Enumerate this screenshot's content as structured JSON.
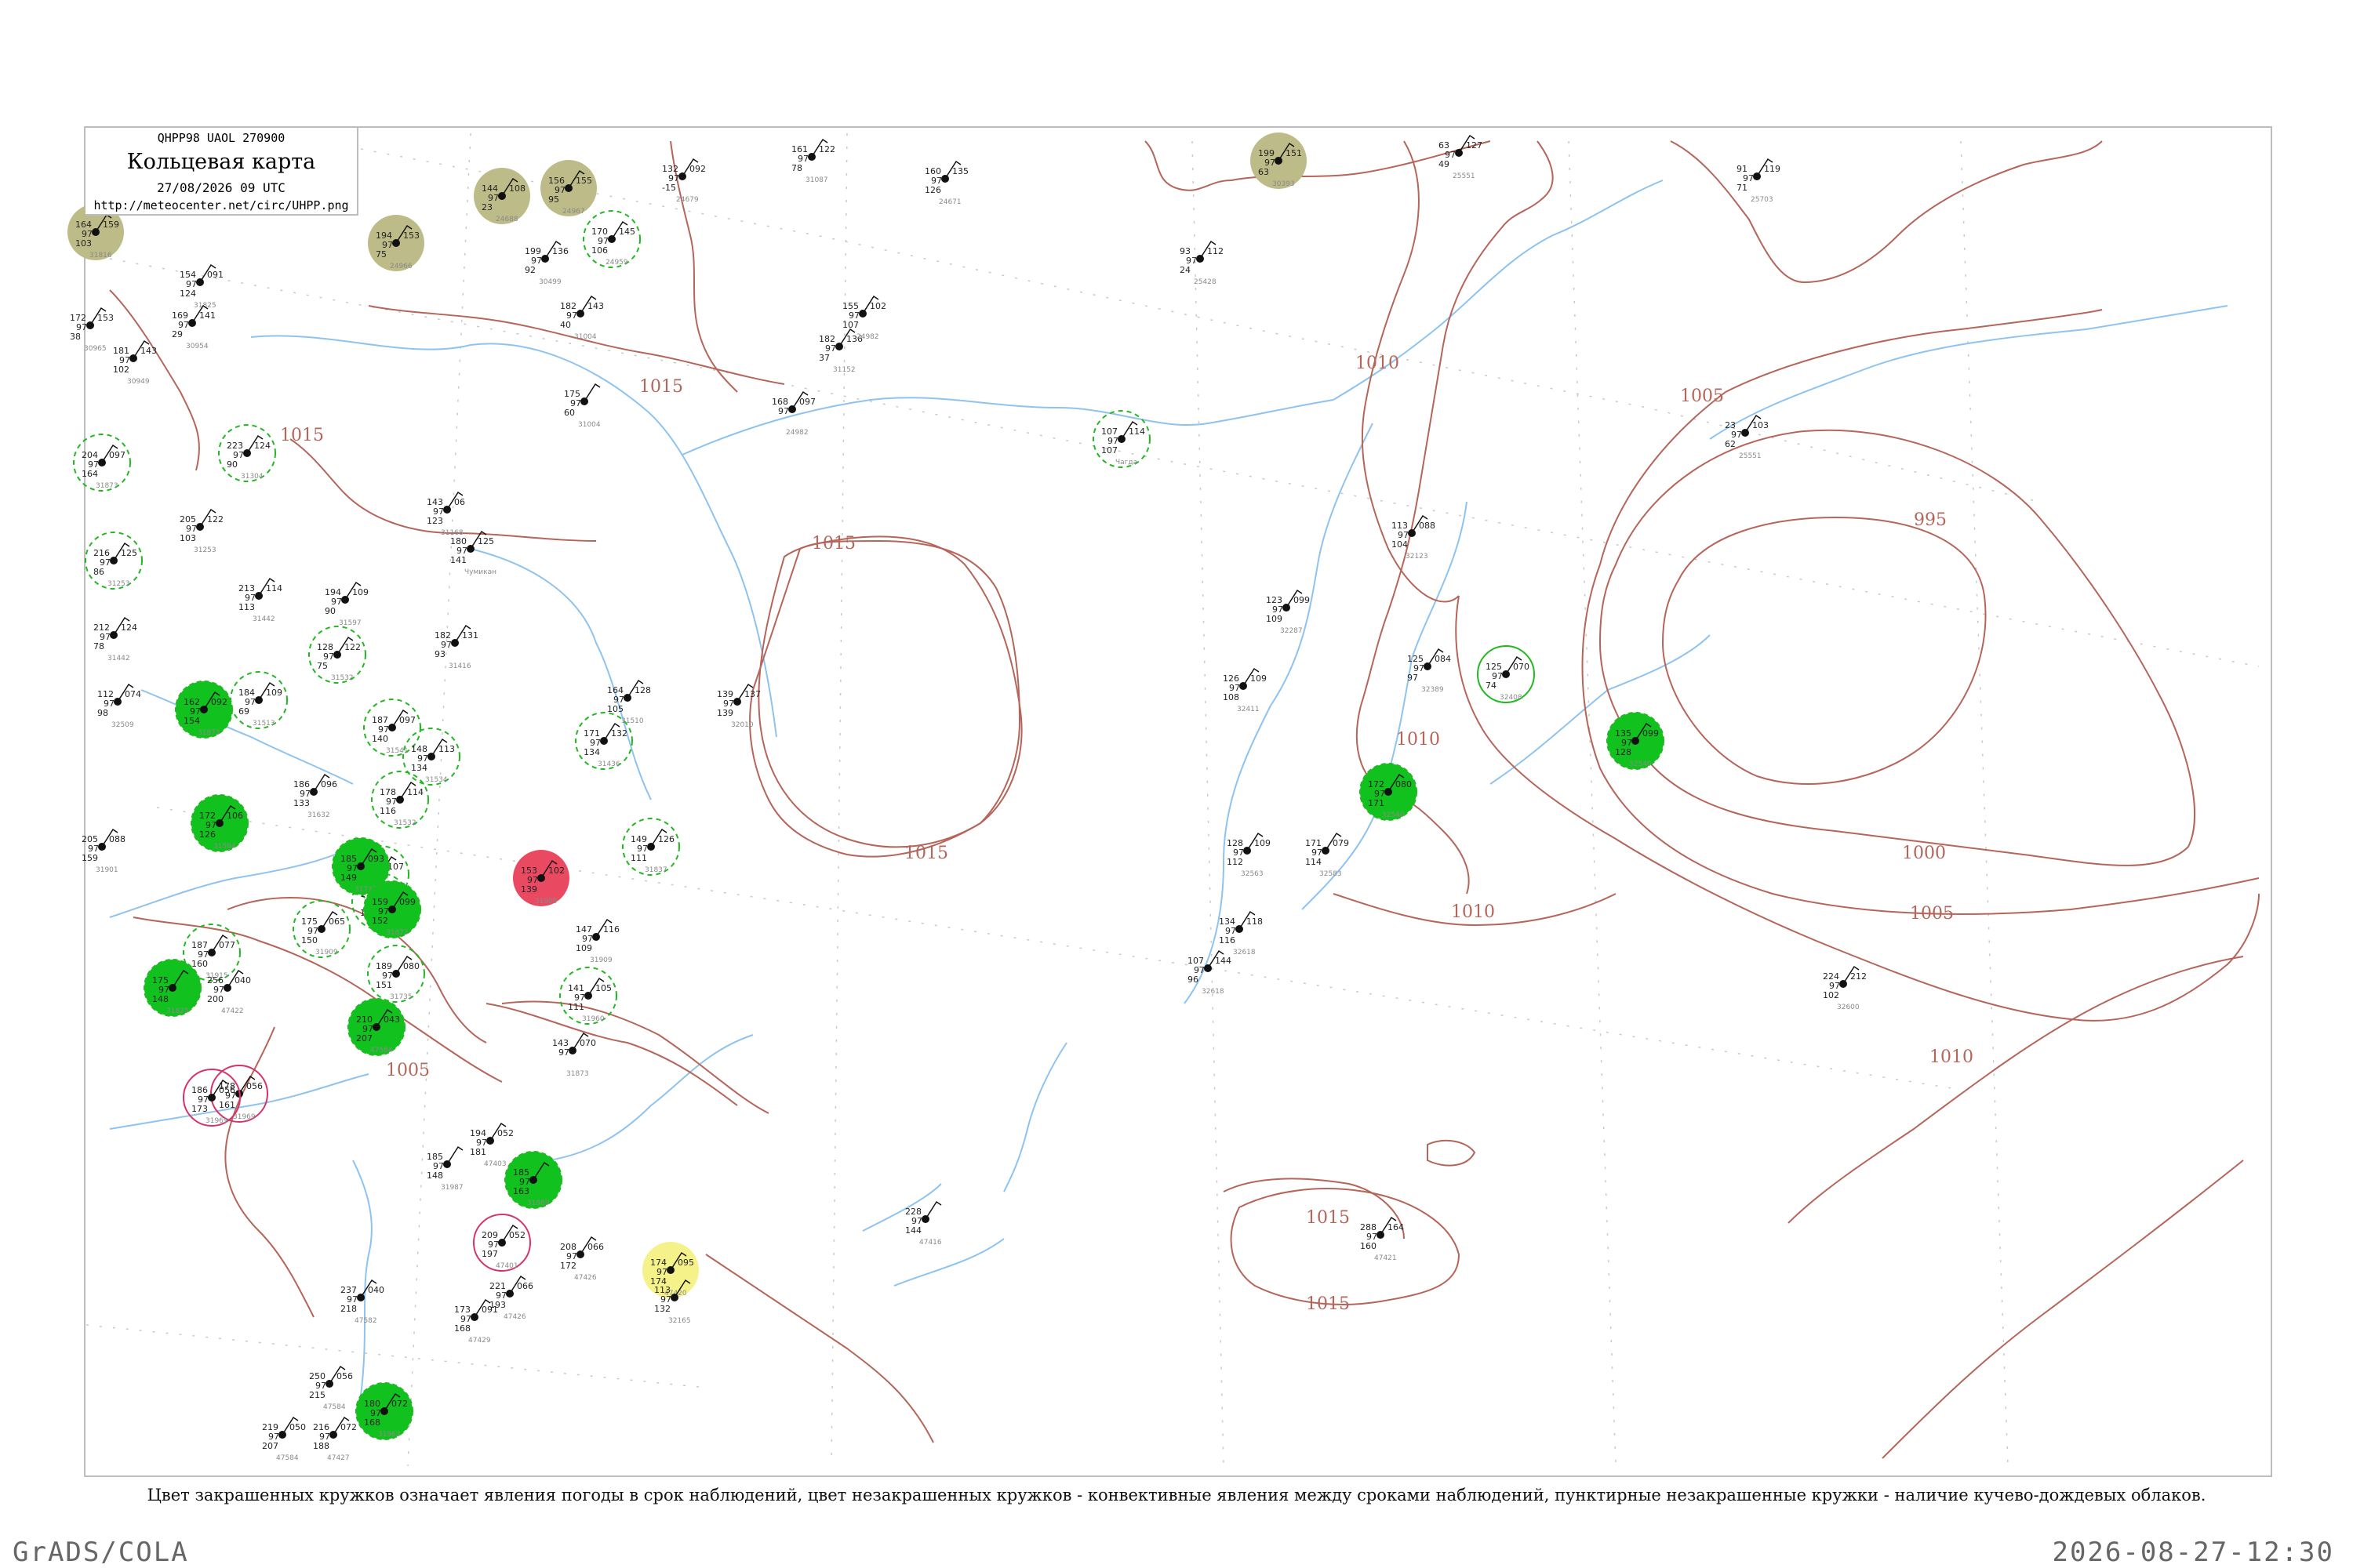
{
  "header": {
    "code_line": "QHPP98  UAOL  270900",
    "title": "Кольцевая карта",
    "date": "27/08/2026 09 UTC",
    "url": "http://meteocenter.net/circ/UHPP.png"
  },
  "caption": "Цвет закрашенных кружков означает явления погоды в срок наблюдений, цвет незакрашенных кружков - конвективные явления между сроками наблюдений, пунктирные незакрашенные кружки - наличие кучево-дождевых облаков.",
  "footer": {
    "left": "GrADS/COLA",
    "right": "2026-08-27-12:30"
  },
  "colors": {
    "isobar": "#b5655a",
    "coast": "#8fc3ef",
    "rain_fill": "#11c21f",
    "rain_ring": "#22b822",
    "thunder_fill": "#e94a62",
    "thunder_ring": "#d6336c",
    "fog_fill": "#bdbb87",
    "drizzle_fill": "#f6f28a"
  },
  "isobar_labels": [
    {
      "text": "1015"
    },
    {
      "text": "1015"
    },
    {
      "text": "1015"
    },
    {
      "text": "1015"
    },
    {
      "text": "1015"
    },
    {
      "text": "1015"
    },
    {
      "text": "1010"
    },
    {
      "text": "1010"
    },
    {
      "text": "1010"
    },
    {
      "text": "1010"
    },
    {
      "text": "1005"
    },
    {
      "text": "1005"
    },
    {
      "text": "1005"
    },
    {
      "text": "1000"
    },
    {
      "text": "995"
    }
  ],
  "stations": [
    {
      "num": "143",
      "val": "06",
      "low": "123",
      "name": "31168",
      "kind": "plain"
    },
    {
      "num": "180",
      "val": "125",
      "low": "141",
      "name": "Чумикан",
      "kind": "plain"
    },
    {
      "num": "128",
      "val": "122",
      "low": "75",
      "name": "31532",
      "kind": "cb"
    },
    {
      "num": "182",
      "val": "131",
      "low": "93",
      "name": "31416",
      "kind": "plain"
    },
    {
      "num": "164",
      "val": "128",
      "low": "105",
      "name": "31510",
      "kind": "plain"
    },
    {
      "num": "139",
      "val": "137",
      "low": "139",
      "name": "32010",
      "kind": "plain"
    },
    {
      "num": "171",
      "val": "132",
      "low": "134",
      "name": "31436",
      "kind": "cb"
    },
    {
      "num": "186",
      "val": "096",
      "low": "133",
      "name": "31632",
      "kind": "plain"
    },
    {
      "num": "149",
      "val": "126",
      "low": "111",
      "name": "31837",
      "kind": "cb"
    },
    {
      "num": "153",
      "val": "102",
      "low": "139",
      "name": "31909",
      "kind": "thunder"
    },
    {
      "num": "147",
      "val": "116",
      "low": "109",
      "name": "31909",
      "kind": "plain"
    },
    {
      "num": "141",
      "val": "105",
      "low": "111",
      "name": "31960",
      "kind": "cb"
    },
    {
      "num": "107",
      "val": "114",
      "low": "107",
      "name": "Чагда",
      "kind": "cb"
    },
    {
      "num": "113",
      "val": "088",
      "low": "104",
      "name": "32123",
      "kind": "plain"
    },
    {
      "num": "123",
      "val": "099",
      "low": "109",
      "name": "32287",
      "kind": "plain"
    },
    {
      "num": "126",
      "val": "109",
      "low": "108",
      "name": "32411",
      "kind": "plain"
    },
    {
      "num": "125",
      "val": "084",
      "low": "97",
      "name": "32389",
      "kind": "plain"
    },
    {
      "num": "125",
      "val": "070",
      "low": "74",
      "name": "32408",
      "kind": "ring"
    },
    {
      "num": "128",
      "val": "109",
      "low": "112",
      "name": "32563",
      "kind": "plain"
    },
    {
      "num": "171",
      "val": "079",
      "low": "114",
      "name": "32583",
      "kind": "plain"
    },
    {
      "num": "134",
      "val": "118",
      "low": "116",
      "name": "32618",
      "kind": "plain"
    },
    {
      "num": "107",
      "val": "144",
      "low": "96",
      "name": "32618",
      "kind": "plain"
    },
    {
      "num": "224",
      "val": "212",
      "low": "102",
      "name": "32600",
      "kind": "plain"
    },
    {
      "num": "228",
      "val": "",
      "low": "144",
      "name": "47416",
      "kind": "plain"
    },
    {
      "num": "288",
      "val": "164",
      "low": "160",
      "name": "47421",
      "kind": "plain"
    },
    {
      "num": "174",
      "val": "095",
      "low": "174",
      "name": "47420",
      "kind": "drizzle"
    },
    {
      "num": "208",
      "val": "066",
      "low": "172",
      "name": "47426",
      "kind": "plain"
    },
    {
      "num": "194",
      "val": "052",
      "low": "181",
      "name": "47403",
      "kind": "plain"
    },
    {
      "num": "185",
      "val": "",
      "low": "148",
      "name": "31987",
      "kind": "plain"
    },
    {
      "num": "209",
      "val": "052",
      "low": "197",
      "name": "47401",
      "kind": "thunder_ring"
    },
    {
      "num": "178",
      "val": "056",
      "low": "161",
      "name": "31969",
      "kind": "thunder_ring"
    },
    {
      "num": "186",
      "val": "056",
      "low": "173",
      "name": "31969",
      "kind": "thunder_ring"
    },
    {
      "num": "175",
      "val": "065",
      "low": "150",
      "name": "31909",
      "kind": "cb"
    },
    {
      "num": "187",
      "val": "077",
      "low": "160",
      "name": "31915",
      "kind": "cb"
    },
    {
      "num": "205",
      "val": "088",
      "low": "159",
      "name": "31901",
      "kind": "plain"
    },
    {
      "num": "204",
      "val": "097",
      "low": "164",
      "name": "31873",
      "kind": "cb"
    },
    {
      "num": "223",
      "val": "124",
      "low": "90",
      "name": "31304",
      "kind": "cb"
    },
    {
      "num": "205",
      "val": "122",
      "low": "103",
      "name": "31253",
      "kind": "plain"
    },
    {
      "num": "216",
      "val": "125",
      "low": "86",
      "name": "31253",
      "kind": "cb"
    },
    {
      "num": "212",
      "val": "124",
      "low": "78",
      "name": "31442",
      "kind": "plain"
    },
    {
      "num": "213",
      "val": "114",
      "low": "113",
      "name": "31442",
      "kind": "plain"
    },
    {
      "num": "194",
      "val": "109",
      "low": "90",
      "name": "31597",
      "kind": "plain"
    },
    {
      "num": "184",
      "val": "109",
      "low": "69",
      "name": "31513",
      "kind": "cb"
    },
    {
      "num": "187",
      "val": "097",
      "low": "140",
      "name": "31541",
      "kind": "cb"
    },
    {
      "num": "148",
      "val": "113",
      "low": "134",
      "name": "31534",
      "kind": "cb"
    },
    {
      "num": "178",
      "val": "114",
      "low": "116",
      "name": "31532",
      "kind": "cb"
    },
    {
      "num": "178",
      "val": "107",
      "low": "137",
      "name": "31643",
      "kind": "cb"
    },
    {
      "num": "176",
      "val": "060",
      "low": "141",
      "name": "31735",
      "kind": "cb"
    },
    {
      "num": "189",
      "val": "080",
      "low": "151",
      "name": "31735",
      "kind": "cb"
    },
    {
      "num": "154",
      "val": "091",
      "low": "124",
      "name": "31825",
      "kind": "plain"
    },
    {
      "num": "169",
      "val": "141",
      "low": "29",
      "name": "30954",
      "kind": "plain"
    },
    {
      "num": "172",
      "val": "153",
      "low": "38",
      "name": "30965",
      "kind": "plain"
    },
    {
      "num": "181",
      "val": "143",
      "low": "102",
      "name": "30949",
      "kind": "plain"
    },
    {
      "num": "199",
      "val": "136",
      "low": "92",
      "name": "30499",
      "kind": "plain"
    },
    {
      "num": "182",
      "val": "143",
      "low": "40",
      "name": "31004",
      "kind": "plain"
    },
    {
      "num": "175",
      "val": "",
      "low": "60",
      "name": "31004",
      "kind": "plain"
    },
    {
      "num": "182",
      "val": "136",
      "low": "37",
      "name": "31152",
      "kind": "plain"
    },
    {
      "num": "155",
      "val": "102",
      "low": "107",
      "name": "24982",
      "kind": "plain"
    },
    {
      "num": "168",
      "val": "097",
      "low": "",
      "name": "24982",
      "kind": "plain"
    },
    {
      "num": "161",
      "val": "122",
      "low": "78",
      "name": "31087",
      "kind": "plain"
    },
    {
      "num": "132",
      "val": "092",
      "low": "-15",
      "name": "24679",
      "kind": "plain"
    },
    {
      "num": "160",
      "val": "135",
      "low": "126",
      "name": "24671",
      "kind": "plain"
    },
    {
      "num": "144",
      "val": "108",
      "low": "23",
      "name": "24688",
      "kind": "fog"
    },
    {
      "num": "156",
      "val": "155",
      "low": "95",
      "name": "24967",
      "kind": "fog"
    },
    {
      "num": "170",
      "val": "145",
      "low": "106",
      "name": "24959",
      "kind": "cb"
    },
    {
      "num": "194",
      "val": "153",
      "low": "75",
      "name": "24966",
      "kind": "fog"
    },
    {
      "num": "164",
      "val": "159",
      "low": "103",
      "name": "31816",
      "kind": "fog"
    },
    {
      "num": "199",
      "val": "151",
      "low": "63",
      "name": "30393",
      "kind": "fog"
    },
    {
      "num": "63",
      "val": "127",
      "low": "49",
      "name": "25551",
      "kind": "plain"
    },
    {
      "num": "93",
      "val": "112",
      "low": "24",
      "name": "25428",
      "kind": "plain"
    },
    {
      "num": "91",
      "val": "119",
      "low": "71",
      "name": "25703",
      "kind": "plain"
    },
    {
      "num": "23",
      "val": "103",
      "low": "62",
      "name": "25551",
      "kind": "plain"
    },
    {
      "num": "135",
      "val": "099",
      "low": "128",
      "name": "32540",
      "kind": "rain"
    },
    {
      "num": "172",
      "val": "080",
      "low": "171",
      "name": "32540",
      "kind": "rain"
    },
    {
      "num": "112",
      "val": "074",
      "low": "98",
      "name": "32509",
      "kind": "plain"
    },
    {
      "num": "162",
      "val": "092",
      "low": "154",
      "name": "31873",
      "kind": "rain"
    },
    {
      "num": "172",
      "val": "106",
      "low": "126",
      "name": "31594",
      "kind": "rain"
    },
    {
      "num": "185",
      "val": "093",
      "low": "149",
      "name": "31735",
      "kind": "rain"
    },
    {
      "num": "159",
      "val": "099",
      "low": "152",
      "name": "31873",
      "kind": "rain"
    },
    {
      "num": "175",
      "val": "",
      "low": "148",
      "name": "31825",
      "kind": "rain"
    },
    {
      "num": "210",
      "val": "043",
      "low": "207",
      "name": "47584",
      "kind": "rain"
    },
    {
      "num": "180",
      "val": "072",
      "low": "168",
      "name": "31962",
      "kind": "rain"
    },
    {
      "num": "185",
      "val": "",
      "low": "163",
      "name": "31989",
      "kind": "rain"
    },
    {
      "num": "143",
      "val": "070",
      "low": "",
      "name": "31873",
      "kind": "plain"
    },
    {
      "num": "256",
      "val": "040",
      "low": "200",
      "name": "47422",
      "kind": "plain"
    },
    {
      "num": "237",
      "val": "040",
      "low": "218",
      "name": "47582",
      "kind": "plain"
    },
    {
      "num": "250",
      "val": "056",
      "low": "215",
      "name": "47584",
      "kind": "plain"
    },
    {
      "num": "219",
      "val": "050",
      "low": "207",
      "name": "47584",
      "kind": "plain"
    },
    {
      "num": "216",
      "val": "072",
      "low": "188",
      "name": "47427",
      "kind": "plain"
    },
    {
      "num": "221",
      "val": "066",
      "low": "193",
      "name": "47426",
      "kind": "plain"
    },
    {
      "num": "173",
      "val": "091",
      "low": "168",
      "name": "47429",
      "kind": "plain"
    },
    {
      "num": "113",
      "val": "",
      "low": "132",
      "name": "32165",
      "kind": "plain"
    }
  ]
}
